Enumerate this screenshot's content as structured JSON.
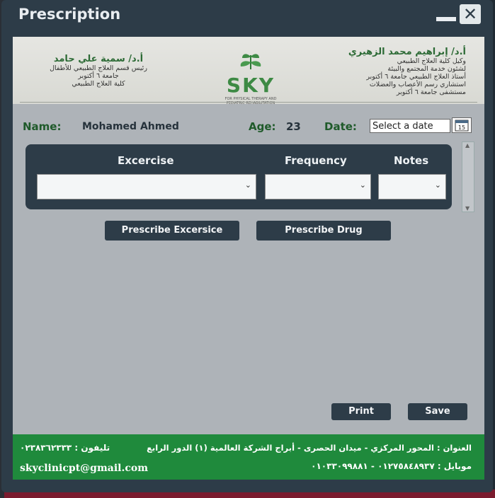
{
  "window": {
    "title": "Prescription",
    "close_glyph": "✕"
  },
  "letterhead": {
    "right": {
      "name": "أ.د/ إبراهيم محمد الزهيري",
      "lines": [
        "وكيل كلية العلاج الطبيعي",
        "لشئون خدمة المجتمع والبيئة",
        "أستاذ العلاج الطبيعي جامعة ٦ أكتوبر",
        "استشاري رسم الأعصاب والعضلات",
        "مستشفى جامعة ٦ أكتوبر"
      ]
    },
    "left": {
      "name": "أ.د/ سمية علي حامد",
      "lines": [
        "رئيس قسم العلاج الطبيعي للأطفال",
        "جامعة ٦ أكتوبر",
        "كلية العلاج الطبيعي"
      ]
    },
    "logo": {
      "word": "SKY",
      "tagline_1": "FOR PHYSICAL THERAPY AND",
      "tagline_2": "PEDIATRIC REHABILITATION"
    }
  },
  "patient": {
    "name_label": "Name:",
    "name_value": "Mohamed Ahmed",
    "age_label": "Age:",
    "age_value": "23",
    "date_label": "Date:",
    "date_placeholder": "Select a date",
    "calendar_day": "15"
  },
  "table": {
    "headers": {
      "exercise": "Excercise",
      "frequency": "Frequency",
      "notes": "Notes"
    }
  },
  "buttons": {
    "prescribe_exercise": "Prescribe Excersice",
    "prescribe_drug": "Prescribe Drug",
    "print": "Print",
    "save": "Save"
  },
  "footer": {
    "phone": "تليفون : ٠٢٣٨٣٦٢٣٣٣",
    "email": "skyclinicpt@gmail.com",
    "address": "العنوان : المحور المركزي - ميدان الحصرى - أبراج الشركة العالمية (١) الدور الرابع",
    "mobile": "موبايل : ٠١٢٧٥٨٤٨٩٣٧ - ٠١٠٣٣٠٩٩٨٨١"
  },
  "colors": {
    "frame": "#2d3c48",
    "accent_green": "#1f8a3c",
    "label_green": "#1f5a2a"
  }
}
